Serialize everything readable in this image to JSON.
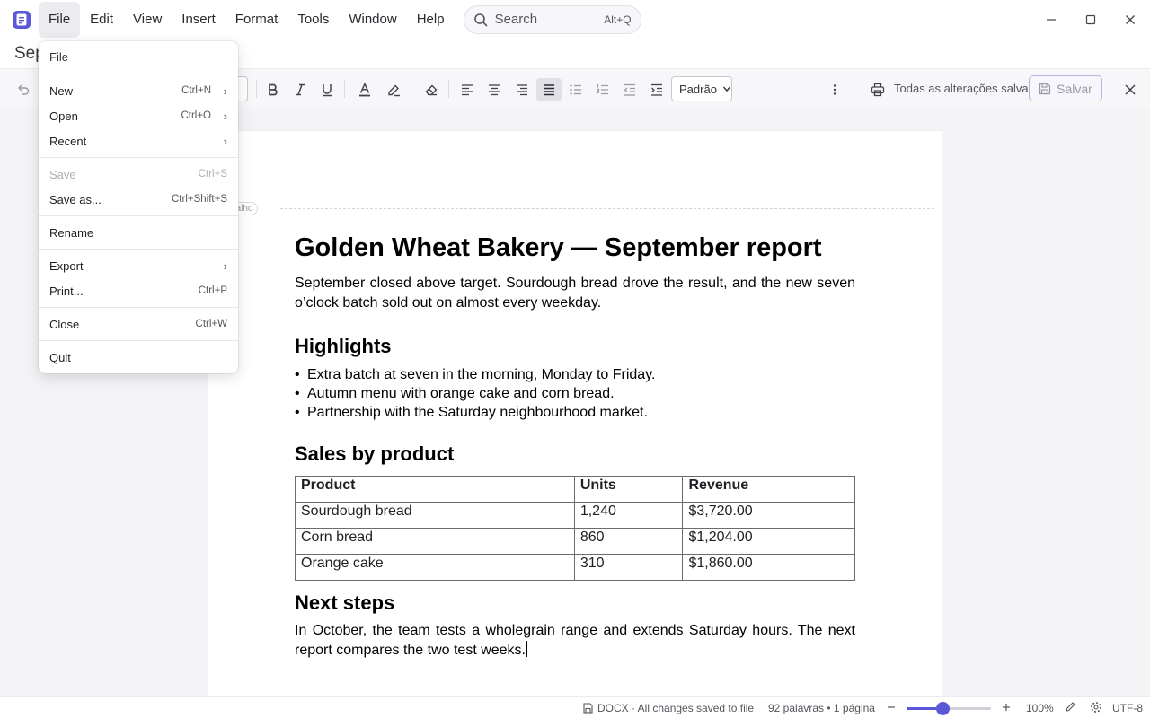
{
  "menubar": {
    "items": [
      "File",
      "Edit",
      "View",
      "Insert",
      "Format",
      "Tools",
      "Window",
      "Help"
    ],
    "active": "File",
    "search": {
      "label": "Search",
      "shortcut": "Alt+Q"
    }
  },
  "title": {
    "text": "Sep"
  },
  "toolbar": {
    "style_select": "Padrão",
    "saved_status": "Todas as alterações salvas",
    "save_label": "Salvar"
  },
  "document": {
    "header_tag": "eçalho",
    "title": "Golden Wheat Bakery — September report",
    "intro": "September closed above target. Sourdough bread drove the result, and the new seven o’clock batch sold out on almost every weekday.",
    "highlights_heading": "Highlights",
    "highlights": [
      "Extra batch at seven in the morning, Monday to Friday.",
      "Autumn menu with orange cake and corn bread.",
      "Partnership with the Saturday neighbourhood market."
    ],
    "sales_heading": "Sales by product",
    "table": {
      "headers": [
        "Product",
        "Units",
        "Revenue"
      ],
      "rows": [
        [
          "Sourdough bread",
          "1,240",
          "$3,720.00"
        ],
        [
          "Corn bread",
          "860",
          "$1,204.00"
        ],
        [
          "Orange cake",
          "310",
          "$1,860.00"
        ]
      ]
    },
    "next_heading": "Next steps",
    "next_text": "In October, the team tests a wholegrain range and extends Saturday hours. The next report compares the two test weeks."
  },
  "statusbar": {
    "file_info": "DOCX · All changes saved to file",
    "counts": "92 palavras • 1 página",
    "zoom": "100%",
    "zoom_level": 0.43,
    "encoding": "UTF-8"
  },
  "file_menu": {
    "header": "File",
    "items": [
      {
        "label": "New",
        "shortcut": "Ctrl+N",
        "submenu": true
      },
      {
        "label": "Open",
        "shortcut": "Ctrl+O",
        "submenu": true
      },
      {
        "label": "Recent",
        "shortcut": "",
        "submenu": true
      },
      {
        "label": "Save",
        "shortcut": "Ctrl+S",
        "disabled": true
      },
      {
        "label": "Save as...",
        "shortcut": "Ctrl+Shift+S"
      },
      {
        "label": "Rename",
        "shortcut": ""
      },
      {
        "label": "Export",
        "shortcut": "",
        "submenu": true
      },
      {
        "label": "Print...",
        "shortcut": "Ctrl+P"
      },
      {
        "label": "Close",
        "shortcut": "Ctrl+W"
      },
      {
        "label": "Quit",
        "shortcut": ""
      }
    ]
  },
  "colors": {
    "accent": "#5b57d9"
  }
}
